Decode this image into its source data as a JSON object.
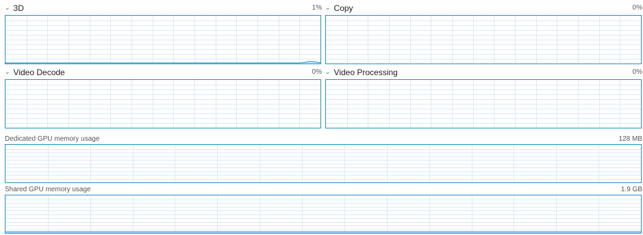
{
  "engines": [
    {
      "name": "3D",
      "percent": "1%",
      "points": [
        0,
        0,
        0,
        0,
        0,
        0,
        0,
        0,
        0,
        0,
        0,
        0,
        0,
        0,
        0,
        0,
        0,
        0,
        0,
        0,
        0,
        0,
        0,
        0,
        0,
        0,
        0,
        0,
        0,
        0,
        0,
        0,
        0,
        0,
        0,
        0,
        0,
        0,
        0,
        0,
        0,
        0,
        0,
        0,
        0,
        0,
        0,
        0,
        0,
        0,
        0,
        0,
        0,
        0,
        0,
        0,
        0,
        1,
        3,
        2,
        0
      ]
    },
    {
      "name": "Copy",
      "percent": "0%",
      "points": []
    },
    {
      "name": "Video Decode",
      "percent": "0%",
      "points": []
    },
    {
      "name": "Video Processing",
      "percent": "0%",
      "points": []
    }
  ],
  "memory": [
    {
      "label": "Dedicated GPU memory usage",
      "value": "128 MB",
      "level": 0
    },
    {
      "label": "Shared GPU memory usage",
      "value": "1.9 GB",
      "level": 0.03
    }
  ],
  "colors": {
    "line": "#1e8fc6",
    "grid": "#d9eaf5"
  },
  "icons": {
    "expand": "chevron-down-icon"
  }
}
